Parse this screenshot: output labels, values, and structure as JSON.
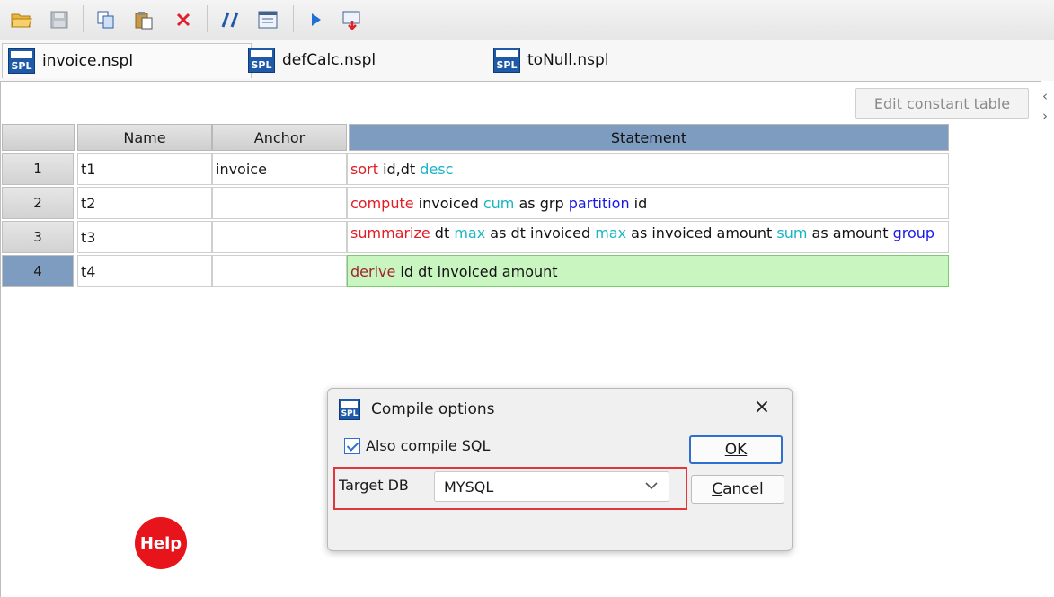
{
  "toolbar": {
    "icons": [
      "open-folder-icon",
      "save-icon",
      "copy-icon",
      "paste-icon",
      "delete-icon",
      "comment-icon",
      "properties-icon",
      "run-icon",
      "compile-icon"
    ]
  },
  "tabs": [
    {
      "label": "invoice.nspl",
      "icon": "spl-file-icon",
      "active": true
    },
    {
      "label": "defCalc.nspl",
      "icon": "spl-file-icon",
      "active": false
    },
    {
      "label": "toNull.nspl",
      "icon": "spl-file-icon",
      "active": false
    }
  ],
  "spl_icon_label": "SPL",
  "edit_constant_label": "Edit constant table",
  "grid": {
    "headers": {
      "name": "Name",
      "anchor": "Anchor",
      "statement": "Statement"
    },
    "rows": [
      {
        "num": "1",
        "name": "t1",
        "anchor": "invoice",
        "tokens": [
          {
            "t": "sort",
            "c": "red"
          },
          {
            "t": " id,dt ",
            "c": "txt"
          },
          {
            "t": "desc",
            "c": "cyan"
          }
        ]
      },
      {
        "num": "2",
        "name": "t2",
        "anchor": "",
        "tokens": [
          {
            "t": "compute",
            "c": "red"
          },
          {
            "t": " invoiced ",
            "c": "txt"
          },
          {
            "t": "cum",
            "c": "cyan"
          },
          {
            "t": " as grp ",
            "c": "txt"
          },
          {
            "t": "partition",
            "c": "blue"
          },
          {
            "t": " id",
            "c": "txt"
          }
        ]
      },
      {
        "num": "3",
        "name": "t3",
        "anchor": "",
        "tokens": [
          {
            "t": "summarize",
            "c": "red"
          },
          {
            "t": " dt ",
            "c": "txt"
          },
          {
            "t": "max",
            "c": "cyan"
          },
          {
            "t": " as dt invoiced ",
            "c": "txt"
          },
          {
            "t": "max",
            "c": "cyan"
          },
          {
            "t": " as invoiced amount ",
            "c": "txt"
          },
          {
            "t": "sum",
            "c": "cyan"
          },
          {
            "t": " as amount ",
            "c": "txt"
          },
          {
            "t": "group",
            "c": "blue"
          }
        ]
      },
      {
        "num": "4",
        "name": "t4",
        "anchor": "",
        "tokens": [
          {
            "t": "derive",
            "c": "maroon"
          },
          {
            "t": " id dt invoiced amount",
            "c": "txt"
          }
        ]
      }
    ]
  },
  "dialog": {
    "title": "Compile options",
    "also_compile_sql": "Also compile SQL",
    "also_compile_checked": true,
    "target_db_label": "Target DB",
    "target_db_value": "MYSQL",
    "ok_label": "OK",
    "cancel_label": "Cancel"
  },
  "help_label": "Help",
  "colors": {
    "accent": "#7d9cc0",
    "selected_cell": "#c8f5c0",
    "keyword_red": "#e31b23",
    "keyword_cyan": "#18b4c4",
    "keyword_blue": "#1a1ae6",
    "help_red": "#e8141b"
  }
}
